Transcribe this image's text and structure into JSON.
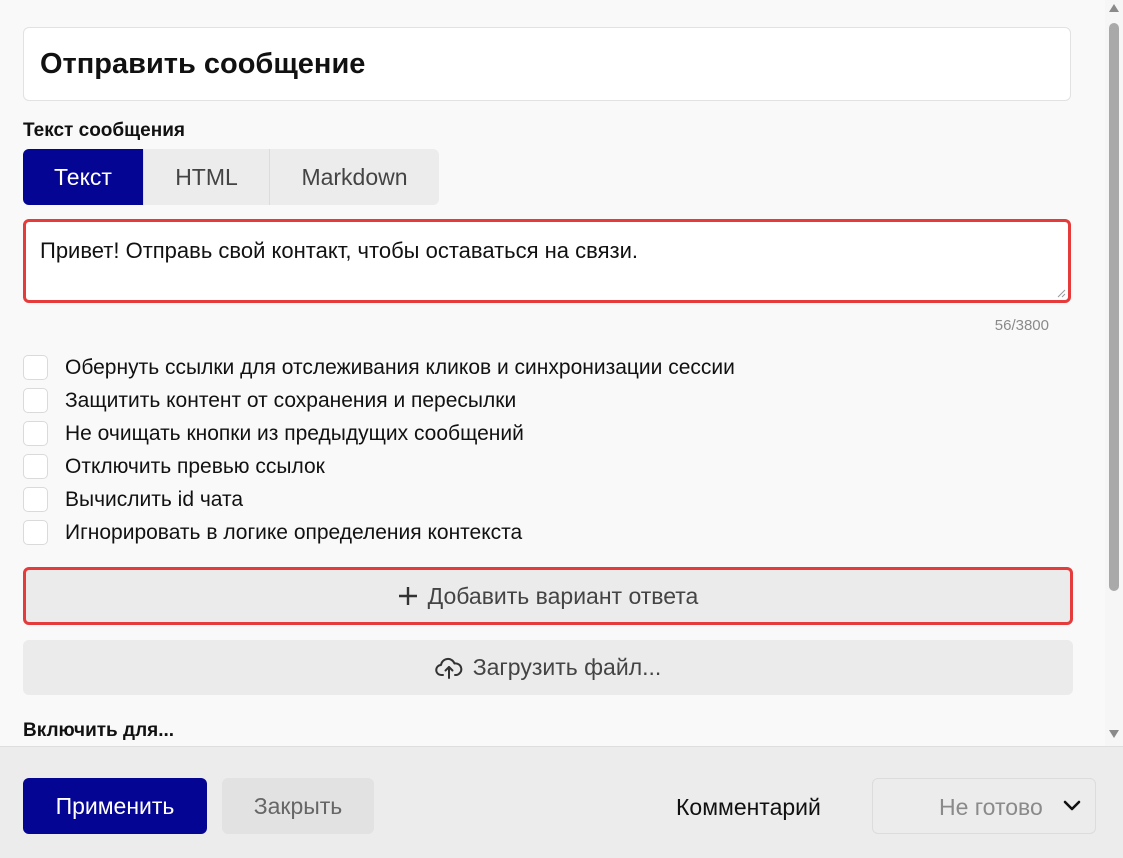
{
  "title": "Отправить сообщение",
  "message_section_label": "Текст сообщения",
  "tabs": [
    {
      "label": "Текст",
      "active": true
    },
    {
      "label": "HTML",
      "active": false
    },
    {
      "label": "Markdown",
      "active": false
    }
  ],
  "message": {
    "value": "Привет! Отправь свой контакт, чтобы оставаться на связи.",
    "counter": "56/3800"
  },
  "options": [
    {
      "label": "Обернуть ссылки для отслеживания кликов и синхронизации сессии",
      "checked": false
    },
    {
      "label": "Защитить контент от сохранения и пересылки",
      "checked": false
    },
    {
      "label": "Не очищать кнопки из предыдущих сообщений",
      "checked": false
    },
    {
      "label": "Отключить превью ссылок",
      "checked": false
    },
    {
      "label": "Вычислить id чата",
      "checked": false
    },
    {
      "label": "Игнорировать в логике определения контекста",
      "checked": false
    }
  ],
  "add_answer_button": "Добавить вариант ответа",
  "upload_button": "Загрузить файл...",
  "enable_for_label": "Включить для...",
  "footer": {
    "apply": "Применить",
    "close": "Закрыть",
    "comment": "Комментарий",
    "status": "Не готово"
  },
  "colors": {
    "accent": "#050593",
    "highlight_border": "#e53b3b"
  },
  "icons": {
    "add": "plus-icon",
    "upload": "cloud-upload-icon",
    "status_dropdown": "chevron-down-icon"
  }
}
